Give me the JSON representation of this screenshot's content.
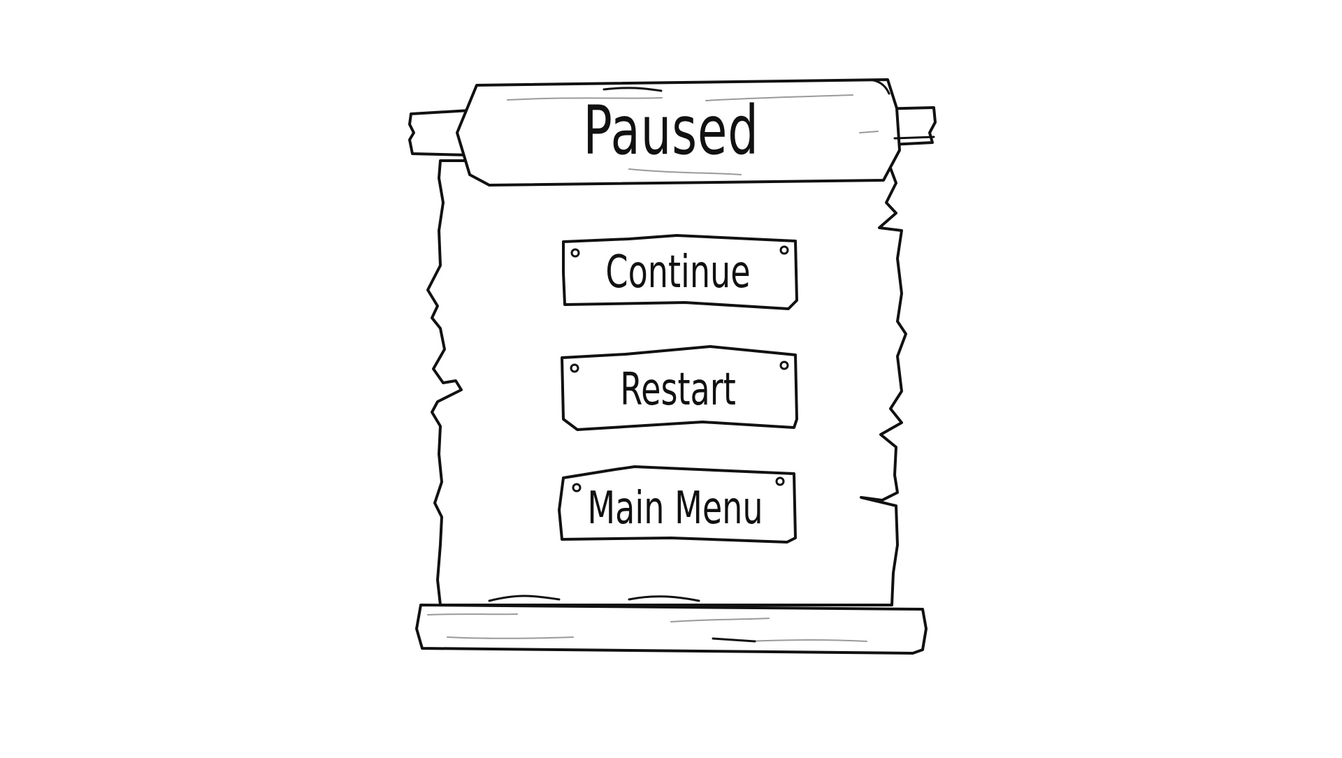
{
  "pause_menu": {
    "title": "Paused",
    "buttons": [
      {
        "id": "continue",
        "label": "Continue"
      },
      {
        "id": "restart",
        "label": "Restart"
      },
      {
        "id": "main_menu",
        "label": "Main Menu"
      }
    ]
  },
  "colors": {
    "ink": "#111111",
    "paper": "#ffffff",
    "sketch_grey": "#9a9a9a"
  }
}
